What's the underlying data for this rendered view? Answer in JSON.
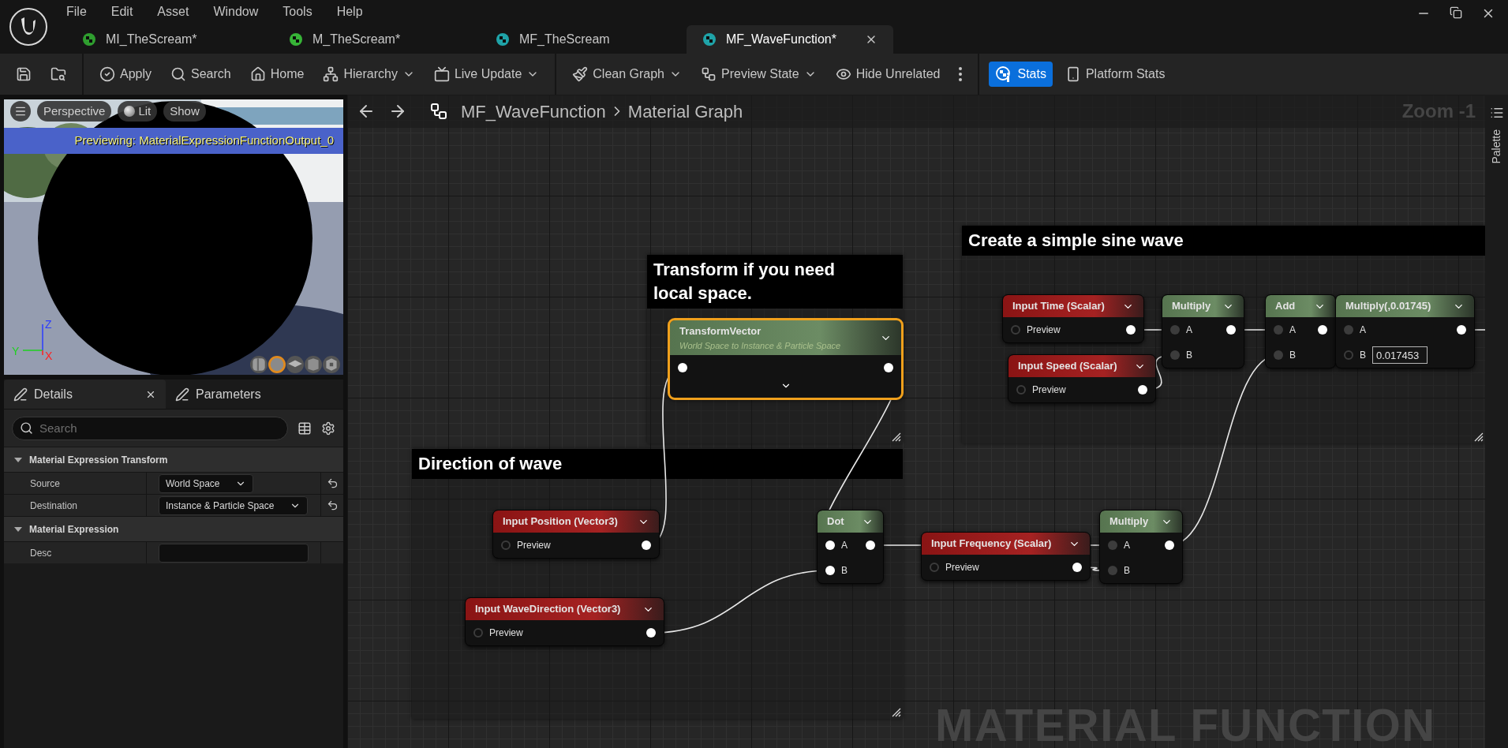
{
  "menu": [
    "File",
    "Edit",
    "Asset",
    "Window",
    "Tools",
    "Help"
  ],
  "asset_tabs": [
    {
      "label": "MI_TheScream*",
      "kind": "instance",
      "selected": false
    },
    {
      "label": "M_TheScream*",
      "kind": "material",
      "selected": false
    },
    {
      "label": "MF_TheScream",
      "kind": "function",
      "selected": false
    },
    {
      "label": "MF_WaveFunction*",
      "kind": "function",
      "selected": true
    }
  ],
  "toolbar_groups": [
    {
      "items": [
        {
          "kind": "save",
          "dropdown": false,
          "active": false
        },
        {
          "kind": "browse",
          "dropdown": false,
          "active": false
        }
      ]
    },
    {
      "items": [
        {
          "kind": "apply",
          "label": "Apply",
          "dropdown": false,
          "active": false
        },
        {
          "kind": "search",
          "label": "Search",
          "dropdown": false,
          "active": false
        },
        {
          "kind": "home",
          "label": "Home",
          "dropdown": false,
          "active": false
        },
        {
          "kind": "hierarchy",
          "label": "Hierarchy",
          "dropdown": true,
          "active": false
        },
        {
          "kind": "live",
          "label": "Live Update",
          "dropdown": true,
          "active": false
        }
      ]
    },
    {
      "items": [
        {
          "kind": "clean",
          "label": "Clean Graph",
          "dropdown": true,
          "active": false
        },
        {
          "kind": "preview",
          "label": "Preview State",
          "dropdown": true,
          "active": false
        },
        {
          "kind": "hide",
          "label": "Hide Unrelated",
          "dropdown": false,
          "active": false
        },
        {
          "kind": "more",
          "dropdown": false,
          "active": false
        }
      ]
    },
    {
      "items": [
        {
          "kind": "stats",
          "label": "Stats",
          "dropdown": false,
          "active": true
        },
        {
          "kind": "platform",
          "label": "Platform Stats",
          "dropdown": false,
          "active": false
        }
      ]
    }
  ],
  "viewport": {
    "buttons": [
      {
        "kind": "menu"
      },
      {
        "kind": "text",
        "label": "Perspective"
      },
      {
        "kind": "lit",
        "label": "Lit"
      },
      {
        "kind": "text",
        "label": "Show"
      }
    ],
    "banner": "Previewing: MaterialExpressionFunctionOutput_0",
    "axes": [
      {
        "label": "Z",
        "color": "#2b3cff"
      },
      {
        "label": "Y",
        "color": "#1fd11f"
      },
      {
        "label": "X",
        "color": "#ff2020"
      }
    ],
    "preview_shapes": [
      {
        "kind": "cylinder",
        "selected": false
      },
      {
        "kind": "sphere",
        "selected": true
      },
      {
        "kind": "plane",
        "selected": false
      },
      {
        "kind": "cube",
        "selected": false
      },
      {
        "kind": "mesh",
        "selected": false
      }
    ]
  },
  "details": {
    "tabs": [
      {
        "label": "Details",
        "selected": true
      },
      {
        "label": "Parameters",
        "selected": false
      }
    ],
    "search": {
      "placeholder": "Search"
    },
    "sections": [
      {
        "title": "Material Expression Transform",
        "expanded": true,
        "rows": [
          {
            "label": "Source",
            "kind": "dropdown",
            "value": "World Space"
          },
          {
            "label": "Destination",
            "kind": "dropdown",
            "value": "Instance & Particle Space"
          }
        ]
      },
      {
        "title": "Material Expression",
        "expanded": true,
        "rows": [
          {
            "label": "Desc",
            "kind": "text"
          }
        ]
      }
    ]
  },
  "graph": {
    "breadcrumb": [
      "MF_WaveFunction",
      "Material Graph"
    ],
    "zoom": "Zoom -1",
    "comments": [
      {
        "text": "Create a simple sine wave"
      },
      {
        "text": "Transform if you need local space."
      },
      {
        "text": "Direction of wave"
      }
    ],
    "nodes": [
      {
        "title": "Input Time (Scalar)",
        "kind": "input",
        "selected": false,
        "advanced": false,
        "rows": [
          {
            "label": "Preview",
            "kind": "unlinked"
          }
        ]
      },
      {
        "title": "Multiply",
        "kind": "math",
        "selected": false,
        "advanced": false,
        "rows": [
          {
            "label": "A",
            "kind": "scalar"
          },
          {
            "label": "B",
            "kind": "scalar"
          }
        ]
      },
      {
        "title": "Add",
        "kind": "math",
        "selected": false,
        "advanced": false,
        "rows": [
          {
            "label": "A",
            "kind": "scalar"
          },
          {
            "label": "B",
            "kind": "scalar"
          }
        ]
      },
      {
        "title": "Multiply(,0.01745)",
        "kind": "math",
        "selected": false,
        "advanced": false,
        "rows": [
          {
            "label": "A",
            "kind": "scalar"
          },
          {
            "label": "B",
            "kind": "unlinked",
            "value": "0.017453"
          }
        ]
      },
      {
        "title": "Input Speed (Scalar)",
        "kind": "input",
        "selected": false,
        "advanced": false,
        "rows": [
          {
            "label": "Preview",
            "kind": "unlinked"
          }
        ]
      },
      {
        "title": "TransformVector",
        "subtitle": "World Space to Instance & Particle Space",
        "kind": "math",
        "selected": true,
        "advanced": true,
        "rows": [
          {
            "kind": "vector"
          }
        ]
      },
      {
        "title": "Input Position (Vector3)",
        "kind": "input",
        "selected": false,
        "advanced": false,
        "rows": [
          {
            "label": "Preview",
            "kind": "unlinked"
          }
        ]
      },
      {
        "title": "Dot",
        "kind": "math",
        "selected": false,
        "advanced": false,
        "rows": [
          {
            "label": "A",
            "kind": "vector"
          },
          {
            "label": "B",
            "kind": "vector"
          }
        ]
      },
      {
        "title": "Input Frequency (Scalar)",
        "kind": "input",
        "selected": false,
        "advanced": false,
        "rows": [
          {
            "label": "Preview",
            "kind": "unlinked"
          }
        ]
      },
      {
        "title": "Multiply",
        "kind": "math",
        "selected": false,
        "advanced": false,
        "rows": [
          {
            "label": "A",
            "kind": "scalar"
          },
          {
            "label": "B",
            "kind": "scalar"
          }
        ]
      },
      {
        "title": "Input WaveDirection (Vector3)",
        "kind": "input",
        "selected": false,
        "advanced": false,
        "rows": [
          {
            "label": "Preview",
            "kind": "unlinked"
          }
        ]
      }
    ],
    "watermark": "MATERIAL FUNCTION"
  },
  "palette": {
    "label": "Palette"
  }
}
